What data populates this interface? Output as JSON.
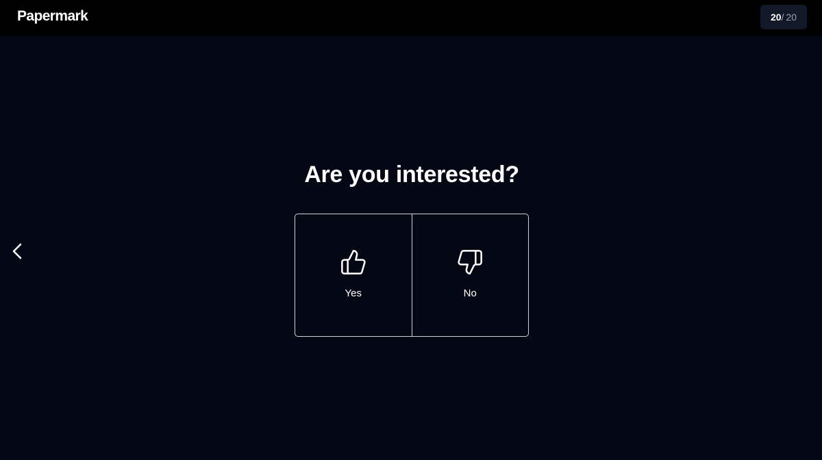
{
  "header": {
    "logo_text": "Papermark",
    "page_counter": {
      "current": "20",
      "separator": "/",
      "total": "20"
    }
  },
  "main": {
    "question": "Are you interested?",
    "options": [
      {
        "label": "Yes",
        "icon": "thumbs-up-icon"
      },
      {
        "label": "No",
        "icon": "thumbs-down-icon"
      }
    ]
  },
  "navigation": {
    "prev_icon": "chevron-left-icon"
  },
  "colors": {
    "background": "#040814",
    "header_background": "#000000",
    "counter_background": "#111827",
    "border": "#d1d5db",
    "text": "#ffffff"
  }
}
